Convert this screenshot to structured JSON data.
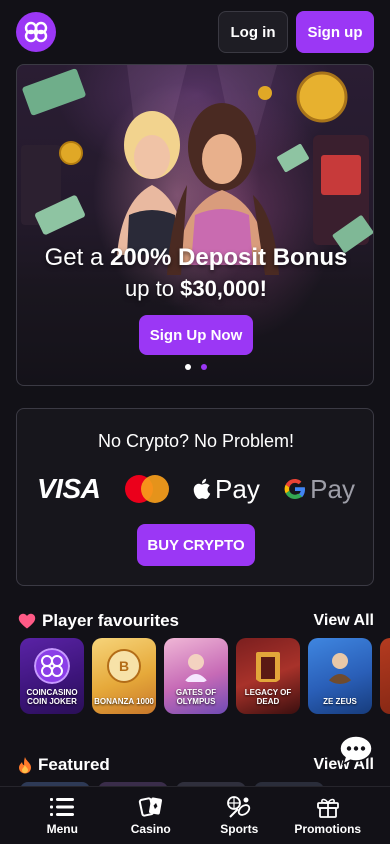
{
  "colors": {
    "accent": "#9b37f5",
    "background": "#121117",
    "card_border": "#3b3a44"
  },
  "header": {
    "logo_icon": "coincasino-logo-icon",
    "login_label": "Log in",
    "signup_label": "Sign up"
  },
  "hero": {
    "title_prefix": "Get a ",
    "title_bold": "200% Deposit Bonus",
    "sub_prefix": "up to ",
    "sub_bold": "$30,000!",
    "cta_label": "Sign Up Now",
    "slides": 2,
    "active_slide": 2
  },
  "crypto": {
    "title": "No Crypto? No Problem!",
    "methods": [
      "VISA",
      "Mastercard",
      "Pay",
      "Pay"
    ],
    "buy_label": "BUY CRYPTO"
  },
  "favourites": {
    "icon": "heart-icon",
    "title": "Player favourites",
    "view_all": "View All",
    "games": [
      {
        "label": "COINCASINO COIN JOKER"
      },
      {
        "label": "BONANZA 1000"
      },
      {
        "label": "GATES OF OLYMPUS"
      },
      {
        "label": "LEGACY OF DEAD"
      },
      {
        "label": "ZE ZEUS"
      },
      {
        "label": ""
      }
    ]
  },
  "featured": {
    "icon": "fire-icon",
    "title": "Featured",
    "view_all": "View All"
  },
  "nav": [
    {
      "label": "Menu",
      "icon": "menu-icon"
    },
    {
      "label": "Casino",
      "icon": "cards-icon"
    },
    {
      "label": "Sports",
      "icon": "sports-icon"
    },
    {
      "label": "Promotions",
      "icon": "gift-icon"
    }
  ]
}
